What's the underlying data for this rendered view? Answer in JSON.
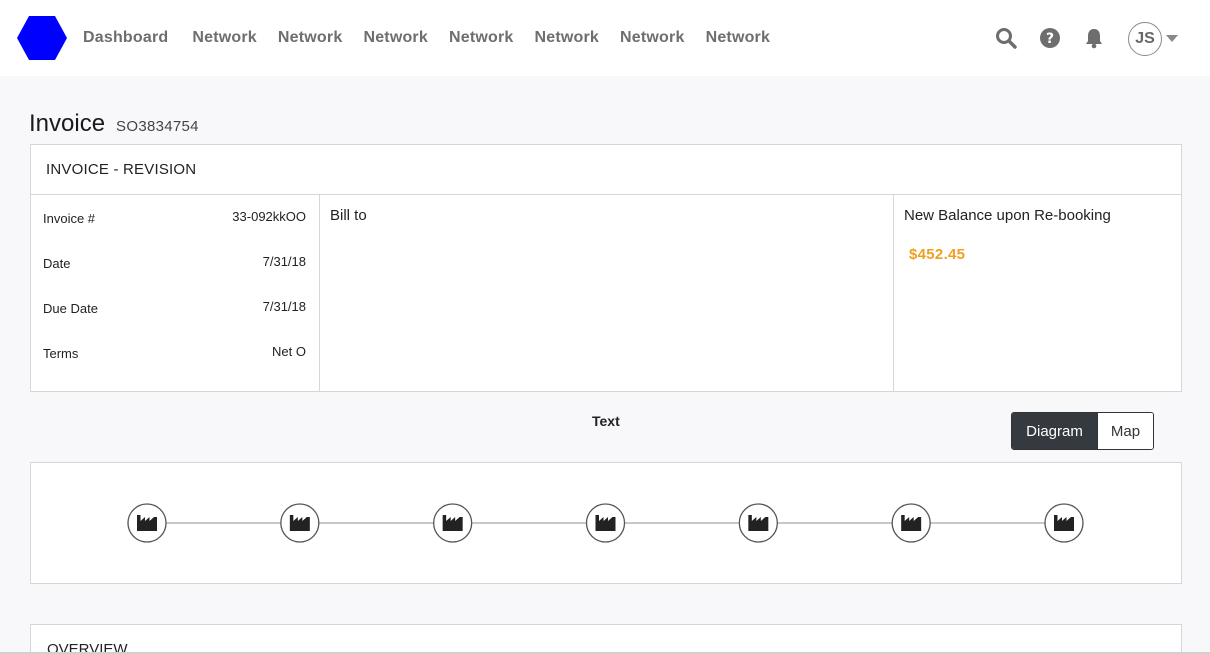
{
  "nav": {
    "items": [
      "Dashboard",
      "Network",
      "Network",
      "Network",
      "Network",
      "Network",
      "Network",
      "Network"
    ]
  },
  "user": {
    "initials": "JS"
  },
  "icons": {
    "logo": "blue-hexagon",
    "search": "search-icon",
    "help": "help-icon",
    "bell": "bell-icon"
  },
  "colors": {
    "logo": "#0000ff",
    "balance": "#f0a020",
    "toggle_active": "#343a40"
  },
  "page": {
    "title": "Invoice",
    "number": "SO3834754"
  },
  "invoice": {
    "header": "INVOICE - REVISION",
    "fields": [
      {
        "label": "Invoice #",
        "value": "33-092kkOO"
      },
      {
        "label": "Date",
        "value": "7/31/18"
      },
      {
        "label": "Due Date",
        "value": "7/31/18"
      },
      {
        "label": "Terms",
        "value": "Net O"
      }
    ],
    "bill_to_label": "Bill to",
    "balance_label": "New Balance upon Re-booking",
    "balance_value": "$452.45"
  },
  "view": {
    "label": "Text",
    "options": [
      "Diagram",
      "Map"
    ],
    "selected": "Diagram"
  },
  "diagram": {
    "node_count": 7,
    "node_icon": "factory-icon"
  },
  "overview": {
    "header": "OVERVIEW"
  }
}
